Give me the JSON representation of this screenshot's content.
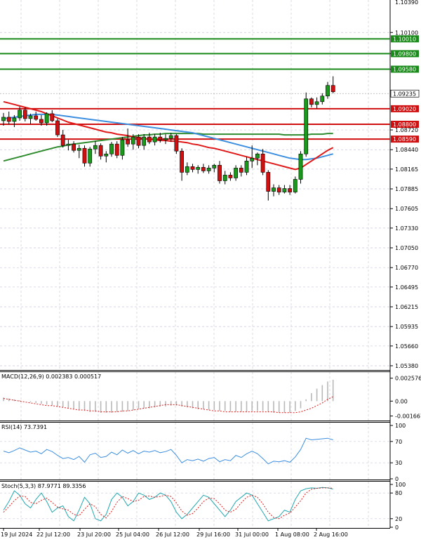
{
  "chart_data": {
    "type": "candlestick",
    "symbol": "EURUSD",
    "price_ticks": [
      "1.10100",
      "1.09800",
      "1.09580",
      "1.08720",
      "1.08440",
      "1.08165",
      "1.07885",
      "1.07605",
      "1.07330",
      "1.07050",
      "1.06770",
      "1.06495",
      "1.06215",
      "1.05935",
      "1.05660",
      "1.05380"
    ],
    "price_top_label": "1.10390",
    "ylim": [
      1.0532,
      1.1056
    ],
    "levels": [
      {
        "price": 1.1001,
        "label": "1.10010",
        "color": "#1a8a1a"
      },
      {
        "price": 1.098,
        "label": "1.09800",
        "color": "#1a8a1a"
      },
      {
        "price": 1.0958,
        "label": "1.09580",
        "color": "#1a8a1a"
      },
      {
        "price": 1.0902,
        "label": "1.09020",
        "color": "#d01010"
      },
      {
        "price": 1.088,
        "label": "1.08800",
        "color": "#d01010"
      },
      {
        "price": 1.0859,
        "label": "1.08590",
        "color": "#d01010"
      }
    ],
    "current_price": {
      "price": 1.09235,
      "label": "1.09235"
    },
    "x_labels": [
      "19 Jul 2024",
      "22 Jul 12:00",
      "23 Jul 20:00",
      "25 Jul 04:00",
      "26 Jul 12:00",
      "29 Jul 16:00",
      "31 Jul 00:00",
      "1 Aug 08:00",
      "2 Aug 16:00"
    ],
    "candles": [
      [
        1.0885,
        1.0896,
        1.0878,
        1.089
      ],
      [
        1.089,
        1.0898,
        1.088,
        1.0884
      ],
      [
        1.0884,
        1.0893,
        1.0876,
        1.0889
      ],
      [
        1.0889,
        1.0905,
        1.0885,
        1.09
      ],
      [
        1.09,
        1.0904,
        1.0884,
        1.0888
      ],
      [
        1.0888,
        1.0895,
        1.088,
        1.0892
      ],
      [
        1.0892,
        1.0898,
        1.0885,
        1.0887
      ],
      [
        1.0887,
        1.0893,
        1.0878,
        1.0882
      ],
      [
        1.0882,
        1.0897,
        1.0878,
        1.0895
      ],
      [
        1.0895,
        1.09,
        1.0883,
        1.0885
      ],
      [
        1.0885,
        1.0888,
        1.0862,
        1.0865
      ],
      [
        1.0865,
        1.0872,
        1.0847,
        1.085
      ],
      [
        1.085,
        1.0858,
        1.0843,
        1.0852
      ],
      [
        1.0852,
        1.0856,
        1.084,
        1.0843
      ],
      [
        1.0843,
        1.0851,
        1.0832,
        1.0846
      ],
      [
        1.0846,
        1.085,
        1.082,
        1.0825
      ],
      [
        1.0825,
        1.0848,
        1.082,
        1.0845
      ],
      [
        1.0845,
        1.0856,
        1.0838,
        1.085
      ],
      [
        1.085,
        1.0853,
        1.083,
        1.0835
      ],
      [
        1.0835,
        1.0842,
        1.0826,
        1.0838
      ],
      [
        1.0838,
        1.0855,
        1.0834,
        1.0852
      ],
      [
        1.0852,
        1.0856,
        1.0832,
        1.0836
      ],
      [
        1.0836,
        1.0862,
        1.083,
        1.0858
      ],
      [
        1.0858,
        1.0874,
        1.0848,
        1.0852
      ],
      [
        1.0852,
        1.0866,
        1.0844,
        1.0862
      ],
      [
        1.0862,
        1.0866,
        1.0846,
        1.085
      ],
      [
        1.085,
        1.0866,
        1.0844,
        1.0862
      ],
      [
        1.0862,
        1.0868,
        1.0852,
        1.0855
      ],
      [
        1.0855,
        1.0866,
        1.085,
        1.0862
      ],
      [
        1.0862,
        1.0868,
        1.0854,
        1.0858
      ],
      [
        1.0858,
        1.0866,
        1.0852,
        1.086
      ],
      [
        1.086,
        1.0868,
        1.0855,
        1.0864
      ],
      [
        1.0864,
        1.0866,
        1.0838,
        1.0842
      ],
      [
        1.0842,
        1.0846,
        1.08,
        1.0812
      ],
      [
        1.0812,
        1.0826,
        1.0808,
        1.082
      ],
      [
        1.082,
        1.0824,
        1.0812,
        1.0816
      ],
      [
        1.0816,
        1.0822,
        1.081,
        1.0819
      ],
      [
        1.0819,
        1.0824,
        1.0811,
        1.0814
      ],
      [
        1.0814,
        1.0822,
        1.081,
        1.0818
      ],
      [
        1.0818,
        1.0824,
        1.0812,
        1.0822
      ],
      [
        1.0822,
        1.0828,
        1.0796,
        1.08
      ],
      [
        1.08,
        1.0814,
        1.0795,
        1.0808
      ],
      [
        1.0808,
        1.0812,
        1.08,
        1.0804
      ],
      [
        1.0804,
        1.0822,
        1.08,
        1.0818
      ],
      [
        1.0818,
        1.0822,
        1.0806,
        1.0812
      ],
      [
        1.0812,
        1.0834,
        1.0808,
        1.0828
      ],
      [
        1.0828,
        1.085,
        1.0818,
        1.0832
      ],
      [
        1.0832,
        1.084,
        1.0822,
        1.0838
      ],
      [
        1.0838,
        1.0845,
        1.0808,
        1.0812
      ],
      [
        1.0812,
        1.0815,
        1.0772,
        1.0785
      ],
      [
        1.0785,
        1.0795,
        1.0778,
        1.079
      ],
      [
        1.079,
        1.0794,
        1.078,
        1.0784
      ],
      [
        1.0784,
        1.0794,
        1.0782,
        1.0789
      ],
      [
        1.0789,
        1.0794,
        1.078,
        1.0784
      ],
      [
        1.0784,
        1.0806,
        1.0782,
        1.0802
      ],
      [
        1.0802,
        1.0842,
        1.0796,
        1.0838
      ],
      [
        1.0838,
        1.0925,
        1.0834,
        1.0916
      ],
      [
        1.0916,
        1.0918,
        1.0904,
        1.0908
      ],
      [
        1.0908,
        1.0918,
        1.0902,
        1.0912
      ],
      [
        1.0912,
        1.0924,
        1.0908,
        1.092
      ],
      [
        1.092,
        1.094,
        1.0916,
        1.0935
      ],
      [
        1.0935,
        1.0948,
        1.0924,
        1.0926
      ]
    ],
    "ma_red": [
      1.0912,
      1.091,
      1.0908,
      1.0906,
      1.0904,
      1.0902,
      1.09,
      1.0898,
      1.0895,
      1.0892,
      1.0889,
      1.0886,
      1.0883,
      1.0881,
      1.0879,
      1.0877,
      1.0875,
      1.0873,
      1.0871,
      1.0869,
      1.0868,
      1.0866,
      1.0865,
      1.0864,
      1.0862,
      1.0861,
      1.086,
      1.0859,
      1.0858,
      1.0857,
      1.0857,
      1.0856,
      1.0856,
      1.0855,
      1.0854,
      1.0852,
      1.0851,
      1.0849,
      1.0847,
      1.0846,
      1.0844,
      1.0842,
      1.084,
      1.0838,
      1.0836,
      1.0834,
      1.0832,
      1.083,
      1.0828,
      1.0826,
      1.0824,
      1.0822,
      1.082,
      1.0818,
      1.0816,
      1.0818,
      1.0823,
      1.0828,
      1.0833,
      1.0838,
      1.0843,
      1.0847
    ],
    "ma_blue": [
      1.0888,
      1.0889,
      1.089,
      1.0891,
      1.0892,
      1.0893,
      1.0894,
      1.0894,
      1.0894,
      1.0894,
      1.0893,
      1.0892,
      1.0891,
      1.089,
      1.0889,
      1.0888,
      1.0887,
      1.0886,
      1.0885,
      1.0884,
      1.0883,
      1.0882,
      1.0881,
      1.088,
      1.0879,
      1.0878,
      1.0877,
      1.0876,
      1.0875,
      1.0874,
      1.0873,
      1.0872,
      1.0871,
      1.087,
      1.0869,
      1.0868,
      1.0866,
      1.0864,
      1.0862,
      1.086,
      1.0858,
      1.0856,
      1.0854,
      1.0852,
      1.085,
      1.0848,
      1.0846,
      1.0844,
      1.0842,
      1.084,
      1.0838,
      1.0836,
      1.0834,
      1.0832,
      1.0831,
      1.083,
      1.083,
      1.0831,
      1.0832,
      1.0834,
      1.0836,
      1.0838
    ],
    "ma_green": [
      1.0828,
      1.083,
      1.0832,
      1.0834,
      1.0836,
      1.0838,
      1.084,
      1.0842,
      1.0844,
      1.0846,
      1.0848,
      1.0849,
      1.0851,
      1.0852,
      1.0853,
      1.0854,
      1.0855,
      1.0856,
      1.0857,
      1.0858,
      1.0859,
      1.086,
      1.0861,
      1.0862,
      1.0863,
      1.0864,
      1.0865,
      1.0865,
      1.0866,
      1.0866,
      1.0867,
      1.0867,
      1.0867,
      1.0867,
      1.0867,
      1.0867,
      1.0867,
      1.0866,
      1.0866,
      1.0866,
      1.0866,
      1.0866,
      1.0866,
      1.0866,
      1.0866,
      1.0866,
      1.0866,
      1.0866,
      1.0866,
      1.0866,
      1.0866,
      1.0866,
      1.0865,
      1.0865,
      1.0865,
      1.0865,
      1.0865,
      1.0866,
      1.0866,
      1.0866,
      1.0867,
      1.0867
    ],
    "macd": {
      "title": "MACD(12,26,9) 0.002383 0.000517",
      "ticks": [
        "0.002576",
        "0.00",
        "-0.001667"
      ],
      "ylim": [
        -0.0021,
        0.0031
      ],
      "hist": [
        0.0004,
        0.0003,
        0.0002,
        0.0001,
        0.0,
        -0.0001,
        -0.0002,
        -0.0003,
        -0.0004,
        -0.0005,
        -0.0006,
        -0.0007,
        -0.0008,
        -0.0009,
        -0.001,
        -0.0011,
        -0.0012,
        -0.0012,
        -0.0013,
        -0.0013,
        -0.0013,
        -0.0012,
        -0.0012,
        -0.0011,
        -0.001,
        -0.0009,
        -0.0008,
        -0.0008,
        -0.0007,
        -0.0006,
        -0.0006,
        -0.0005,
        -0.0005,
        -0.0006,
        -0.0007,
        -0.0008,
        -0.0009,
        -0.0009,
        -0.001,
        -0.001,
        -0.0011,
        -0.0011,
        -0.0012,
        -0.0012,
        -0.0012,
        -0.0012,
        -0.0011,
        -0.0011,
        -0.0011,
        -0.0012,
        -0.0013,
        -0.0013,
        -0.0013,
        -0.0013,
        -0.0011,
        -0.0008,
        0.0002,
        0.0009,
        0.0014,
        0.0018,
        0.0022,
        0.0024
      ],
      "signal": [
        0.0003,
        0.0002,
        0.0001,
        0.0,
        -0.0001,
        -0.0002,
        -0.0003,
        -0.0004,
        -0.0005,
        -0.0005,
        -0.0006,
        -0.0007,
        -0.0008,
        -0.0009,
        -0.001,
        -0.001,
        -0.0011,
        -0.0011,
        -0.0012,
        -0.0012,
        -0.0012,
        -0.0012,
        -0.0011,
        -0.0011,
        -0.001,
        -0.0009,
        -0.0008,
        -0.0007,
        -0.0006,
        -0.0005,
        -0.0004,
        -0.0004,
        -0.0004,
        -0.0005,
        -0.0006,
        -0.0007,
        -0.0008,
        -0.0009,
        -0.001,
        -0.0011,
        -0.0011,
        -0.0012,
        -0.0012,
        -0.0012,
        -0.0012,
        -0.0012,
        -0.0012,
        -0.0012,
        -0.0012,
        -0.0012,
        -0.0012,
        -0.0013,
        -0.0013,
        -0.0013,
        -0.0013,
        -0.0012,
        -0.001,
        -0.0008,
        -0.0005,
        -0.0002,
        0.0002,
        0.0005
      ]
    },
    "rsi": {
      "title": "RSI(14) 73.7391",
      "ticks": [
        "100",
        "70",
        "30",
        "0"
      ],
      "ylim": [
        0,
        100
      ],
      "values": [
        52,
        49,
        53,
        58,
        54,
        50,
        52,
        47,
        55,
        51,
        44,
        38,
        40,
        36,
        42,
        31,
        45,
        48,
        40,
        42,
        50,
        45,
        54,
        48,
        53,
        47,
        52,
        50,
        53,
        49,
        51,
        55,
        44,
        30,
        36,
        34,
        37,
        33,
        38,
        40,
        32,
        36,
        34,
        44,
        40,
        47,
        52,
        47,
        38,
        28,
        33,
        32,
        34,
        31,
        41,
        55,
        76,
        73,
        74,
        75,
        76,
        73
      ]
    },
    "stoch": {
      "title": "Stoch(5,3,3) 87.9771 89.3356",
      "ticks": [
        "100",
        "80",
        "20",
        "0"
      ],
      "ylim": [
        0,
        100
      ],
      "k": [
        40,
        60,
        85,
        75,
        55,
        45,
        65,
        80,
        60,
        35,
        45,
        50,
        25,
        15,
        40,
        70,
        55,
        20,
        15,
        30,
        65,
        80,
        70,
        50,
        60,
        80,
        75,
        65,
        70,
        80,
        75,
        60,
        35,
        20,
        30,
        45,
        60,
        75,
        70,
        55,
        40,
        25,
        40,
        60,
        70,
        80,
        75,
        55,
        35,
        15,
        20,
        25,
        40,
        35,
        65,
        85,
        90,
        92,
        91,
        93,
        92,
        89
      ],
      "d": [
        35,
        48,
        62,
        73,
        72,
        58,
        55,
        63,
        68,
        58,
        47,
        43,
        40,
        30,
        27,
        42,
        55,
        48,
        30,
        22,
        37,
        58,
        72,
        67,
        60,
        63,
        72,
        73,
        70,
        72,
        75,
        72,
        57,
        38,
        28,
        32,
        45,
        60,
        68,
        67,
        55,
        40,
        35,
        42,
        57,
        70,
        75,
        70,
        55,
        35,
        23,
        20,
        28,
        33,
        47,
        62,
        80,
        89,
        91,
        92,
        92,
        91
      ]
    }
  }
}
